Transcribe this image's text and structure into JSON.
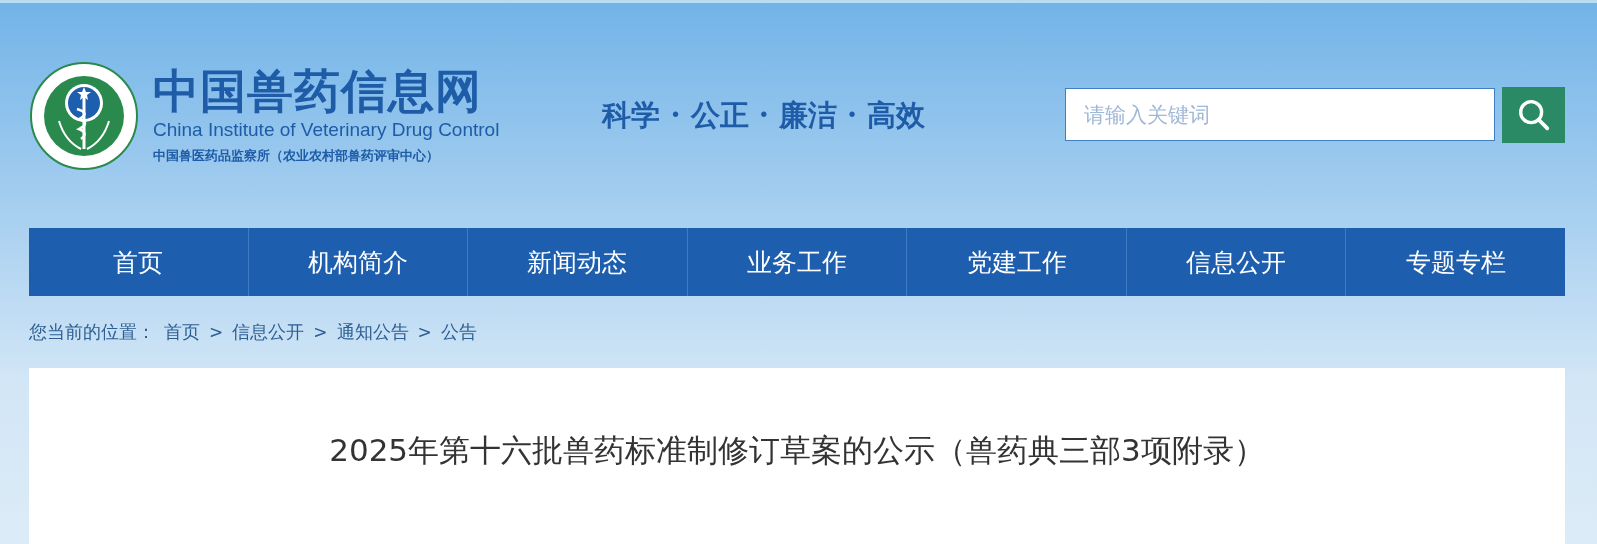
{
  "header": {
    "site_title": "中国兽药信息网",
    "site_subtitle_en": "China Institute of Veterinary Drug Control",
    "site_subtitle_cn": "中国兽医药品监察所（农业农村部兽药评审中心）",
    "motto": "科学 · 公正 · 廉洁 · 高效"
  },
  "search": {
    "placeholder": "请输入关键词"
  },
  "nav": [
    {
      "label": "首页",
      "selected": false
    },
    {
      "label": "机构简介",
      "selected": false
    },
    {
      "label": "新闻动态",
      "selected": false
    },
    {
      "label": "业务工作",
      "selected": false
    },
    {
      "label": "党建工作",
      "selected": false
    },
    {
      "label": "信息公开",
      "selected": false
    },
    {
      "label": "专题专栏",
      "selected": false
    }
  ],
  "breadcrumb": {
    "label": "您当前的位置：",
    "items": [
      {
        "kind": "link",
        "text": "首页"
      },
      {
        "kind": "separator",
        "text": ">"
      },
      {
        "kind": "link",
        "text": "信息公开"
      },
      {
        "kind": "separator",
        "text": ">"
      },
      {
        "kind": "link",
        "text": "通知公告"
      },
      {
        "kind": "separator",
        "text": ">"
      },
      {
        "kind": "link",
        "text": "公告"
      }
    ]
  },
  "article": {
    "title": "2025年第十六批兽药标准制修订草案的公示（兽药典三部3项附录）"
  }
}
